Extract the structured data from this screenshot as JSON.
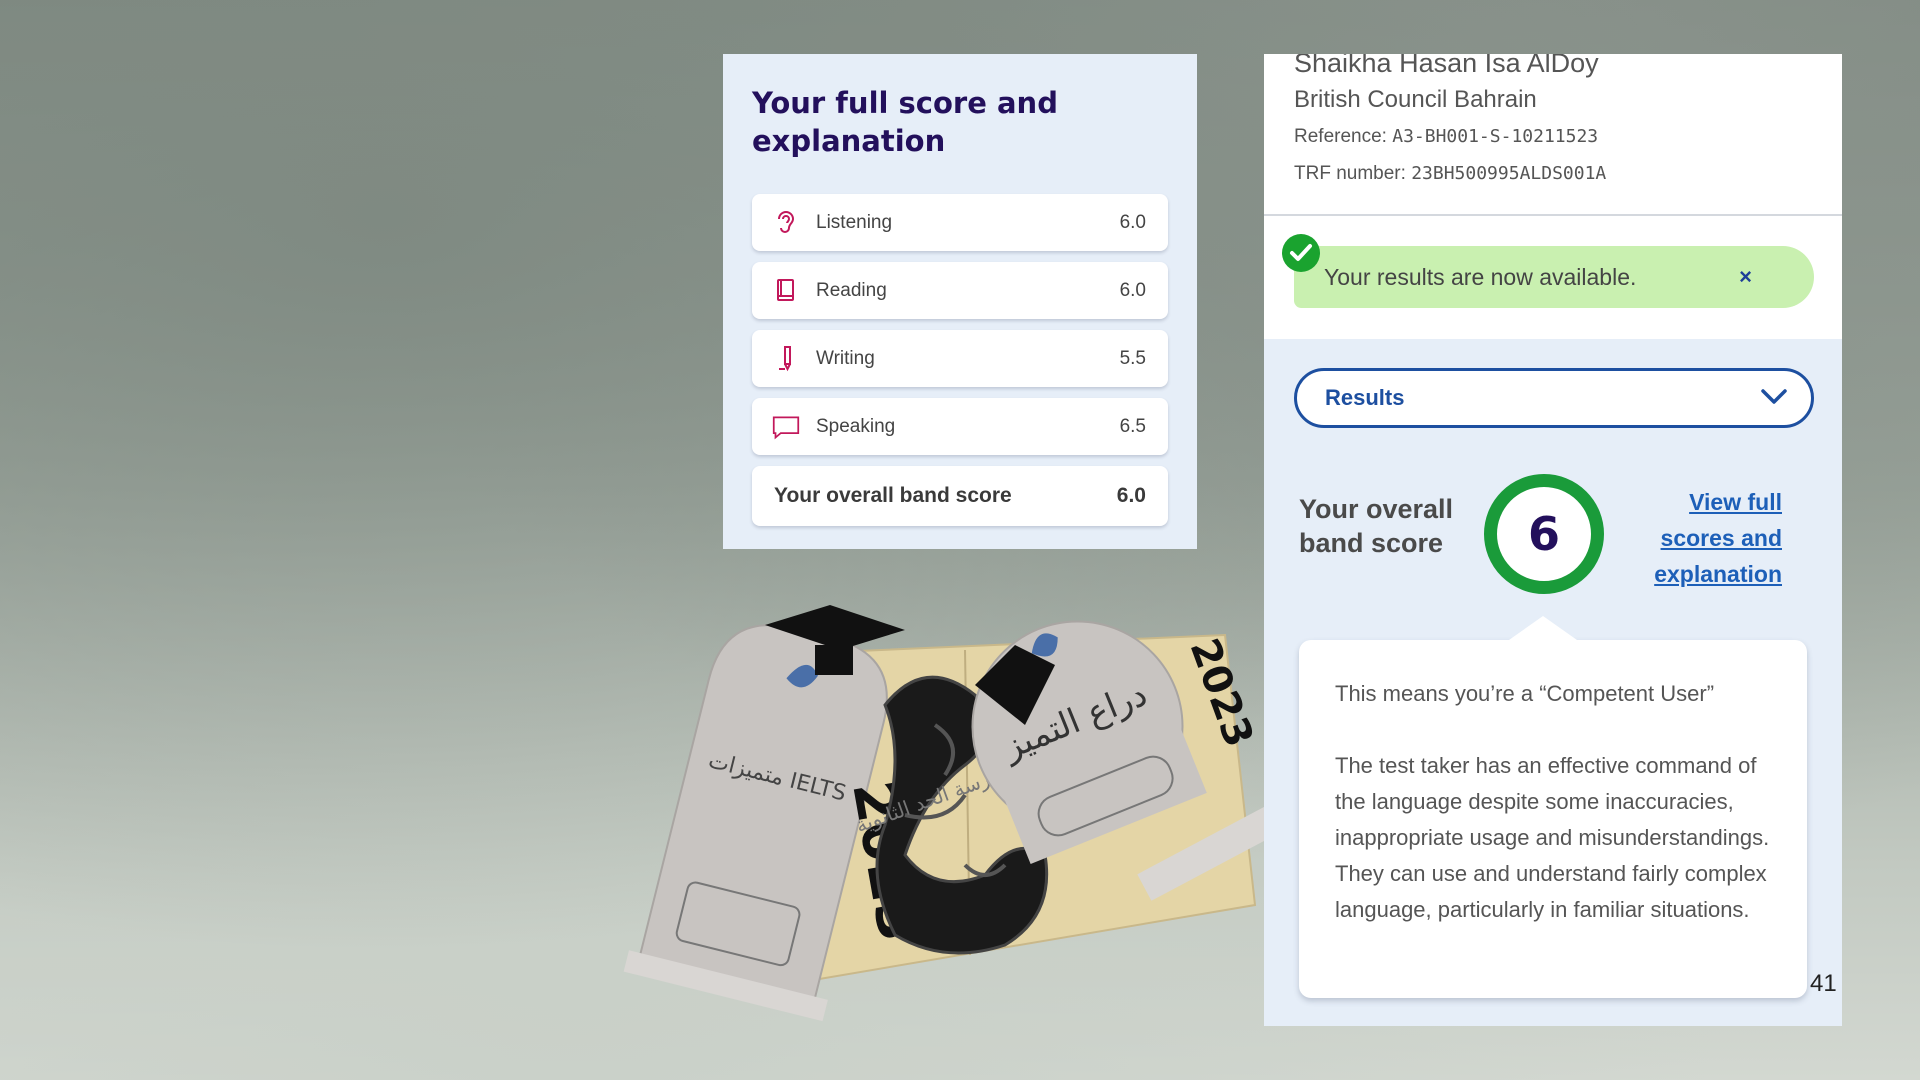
{
  "score_panel": {
    "title": "Your full score and explanation",
    "rows": [
      {
        "label": "Listening",
        "value": "6.0",
        "icon": "ear-icon"
      },
      {
        "label": "Reading",
        "value": "6.0",
        "icon": "book-icon"
      },
      {
        "label": "Writing",
        "value": "5.5",
        "icon": "pen-icon"
      },
      {
        "label": "Speaking",
        "value": "6.5",
        "icon": "speech-bubble-icon"
      }
    ],
    "overall_label": "Your overall band score",
    "overall_value": "6.0"
  },
  "results_panel": {
    "candidate_name": "Shaikha Hasan Isa AlDoy",
    "centre": "British Council Bahrain",
    "reference_label": "Reference:",
    "reference_value": "A3-BH001-S-10211523",
    "trf_label": "TRF number:",
    "trf_value": "23BH500995ALDS001A",
    "notice": "Your results are now available.",
    "notice_close": "×",
    "dropdown_label": "Results",
    "overall_label": "Your overall band score",
    "overall_score": "6",
    "view_link": "View full scores and explanation",
    "competent": "This means you’re a “Competent User”",
    "description": "The test taker has an effective command of the language despite some inaccuracies, inappropriate usage and misunderstandings. They can use and understand fairly complex language, particularly in familiar situations."
  },
  "trophy": {
    "left_plaque_text": "متميزات IELTS",
    "left_year": "2023",
    "center_text": "مدرسة الحد الثانوية",
    "right_plaque_text": "دراع التميز",
    "right_year": "2023"
  },
  "page_number": "41",
  "colors": {
    "accent_navy": "#23105c",
    "link_blue": "#1d5fb8",
    "success_green": "#1a9b3a",
    "notice_green": "#c9f0b0",
    "panel_bg": "#e6eef8"
  }
}
